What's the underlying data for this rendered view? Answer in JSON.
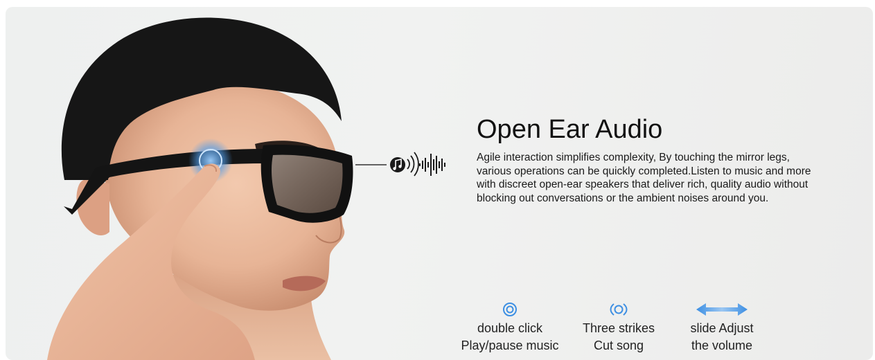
{
  "headline": "Open Ear Audio",
  "description": "Agile interaction simplifies complexity, By touching the mirror legs, various operations can be quickly completed.Listen to music and more with discreet open-ear speakers that deliver rich, quality audio without blocking out conversations or the ambient noises around you.",
  "features": [
    {
      "icon": "double-ring-icon",
      "line1": "double click",
      "line2": "Play/pause music"
    },
    {
      "icon": "pulse-ring-icon",
      "line1": "Three strikes",
      "line2": "Cut song"
    },
    {
      "icon": "double-arrow-icon",
      "line1": "slide Adjust",
      "line2": "the volume"
    }
  ],
  "colors": {
    "accent": "#3d8fe3",
    "background": "#eff0ef",
    "text": "#111111"
  }
}
